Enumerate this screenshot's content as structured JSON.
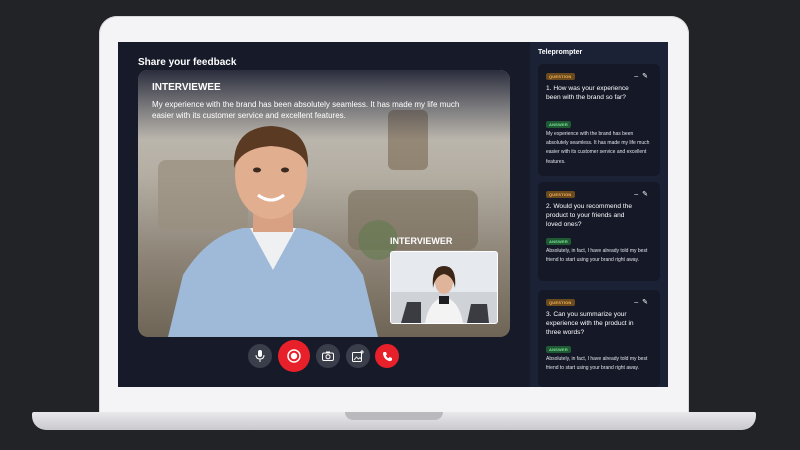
{
  "page_title": "Share your feedback",
  "video": {
    "interviewee_label": "INTERVIEWEE",
    "interviewee_quote": "My experience with the brand has been absolutely seamless. It has made my life much easier with its customer service and excellent features.",
    "interviewer_label": "INTERVIEWER"
  },
  "controls": [
    {
      "name": "microphone",
      "icon": "microphone-icon"
    },
    {
      "name": "record",
      "icon": "record-icon",
      "color": "#e8202a"
    },
    {
      "name": "camera",
      "icon": "camera-icon"
    },
    {
      "name": "add-media",
      "icon": "add-photo-icon"
    },
    {
      "name": "end-call",
      "icon": "phone-icon",
      "color": "#e8202a"
    }
  ],
  "teleprompter": {
    "title": "Teleprompter",
    "cards": [
      {
        "question_tag": "QUESTION",
        "question": "1. How was your experience been with the brand so far?",
        "answer_tag": "ANSWER",
        "answer": "My experience with the brand has been absolutely seamless. It has made my life much easier with its customer service and excellent features."
      },
      {
        "question_tag": "QUESTION",
        "question": "2. Would you recommend the product to your friends and loved ones?",
        "answer_tag": "ANSWER",
        "answer": "Absolutely, in fact, I have already told my best friend to start using your brand right away."
      },
      {
        "question_tag": "QUESTION",
        "question": "3. Can you summarize your experience with the product in three words?",
        "answer_tag": "ANSWER",
        "answer": "Absolutely, in fact, I have already told my best friend to start using your brand right away."
      }
    ]
  },
  "colors": {
    "accent_red": "#e8202a",
    "question_tag": "#f2b35a",
    "answer_tag": "#7fe39b",
    "sidebar_bg": "#1c2236"
  }
}
